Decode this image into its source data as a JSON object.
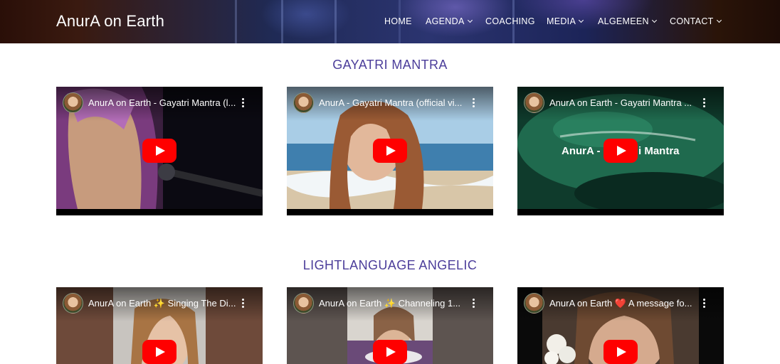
{
  "header": {
    "site_title": "AnurA on Earth",
    "nav": [
      {
        "label": "HOME",
        "has_dropdown": false
      },
      {
        "label": "AGENDA",
        "has_dropdown": true
      },
      {
        "label": "COACHING",
        "has_dropdown": false
      },
      {
        "label": "MEDIA",
        "has_dropdown": true
      },
      {
        "label": "ALGEMEEN",
        "has_dropdown": true
      },
      {
        "label": "CONTACT",
        "has_dropdown": true
      }
    ]
  },
  "sections": [
    {
      "title": "GAYATRI MANTRA",
      "videos": [
        {
          "title": "AnurA on Earth - Gayatri Mantra (l..."
        },
        {
          "title": "AnurA - Gayatri Mantra (official vi..."
        },
        {
          "title": "AnurA on Earth - Gayatri Mantra ...",
          "overlay_left": "AnurA -",
          "overlay_right": "i Mantra"
        }
      ]
    },
    {
      "title": "LIGHTLANGUAGE ANGELIC",
      "videos": [
        {
          "title": "AnurA on Earth ✨ Singing The Di..."
        },
        {
          "title": "AnurA on Earth ✨ Channeling 1..."
        },
        {
          "title": "AnurA on Earth ❤️ A message fo..."
        }
      ]
    }
  ],
  "colors": {
    "section_title": "#4b3d9a",
    "play_button": "#ff0000"
  },
  "icons": {
    "dropdown": "chevron-down-icon",
    "menu": "more-vert-icon",
    "play": "youtube-play-icon"
  }
}
